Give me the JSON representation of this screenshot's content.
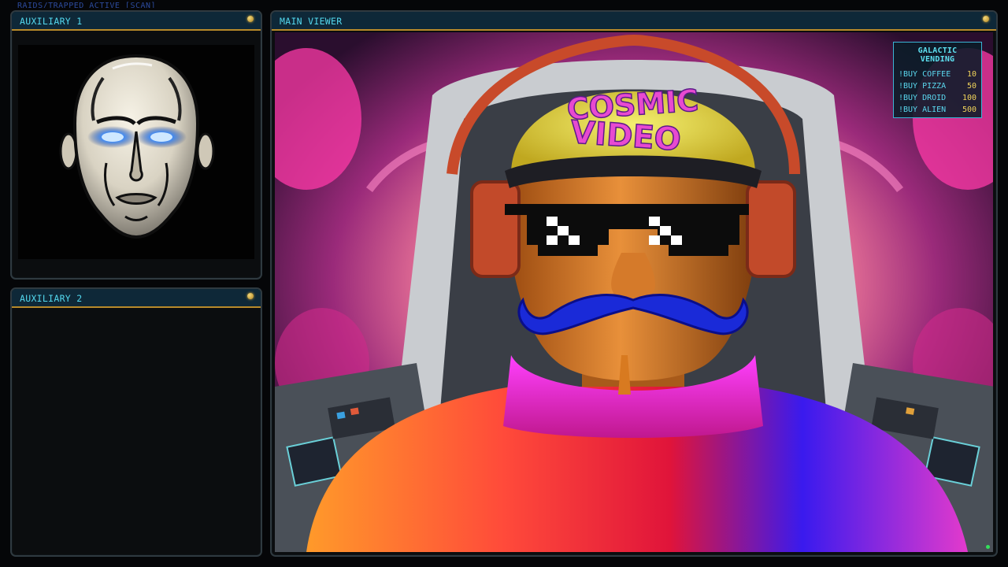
{
  "top_status": "RAIDS/TRAPPED ACTIVE [SCAN]",
  "panels": {
    "aux1": {
      "title": "AUXILIARY 1"
    },
    "aux2": {
      "title": "AUXILIARY 2"
    },
    "main": {
      "title": "MAIN VIEWER"
    }
  },
  "main_viewer": {
    "cap_text_line1": "COSMIC",
    "cap_text_line2": "VIDEO"
  },
  "vending": {
    "title": "GALACTIC VENDING",
    "items": [
      {
        "label": "!BUY COFFEE",
        "price": "10"
      },
      {
        "label": "!BUY PIZZA",
        "price": "50"
      },
      {
        "label": "!BUY DROID",
        "price": "100"
      },
      {
        "label": "!BUY ALIEN",
        "price": "500"
      }
    ]
  },
  "colors": {
    "panel_header_bg": "#0e2838",
    "panel_title": "#53d8ee",
    "accent_gold": "#b88a2a",
    "vending_price": "#f0d35a"
  }
}
